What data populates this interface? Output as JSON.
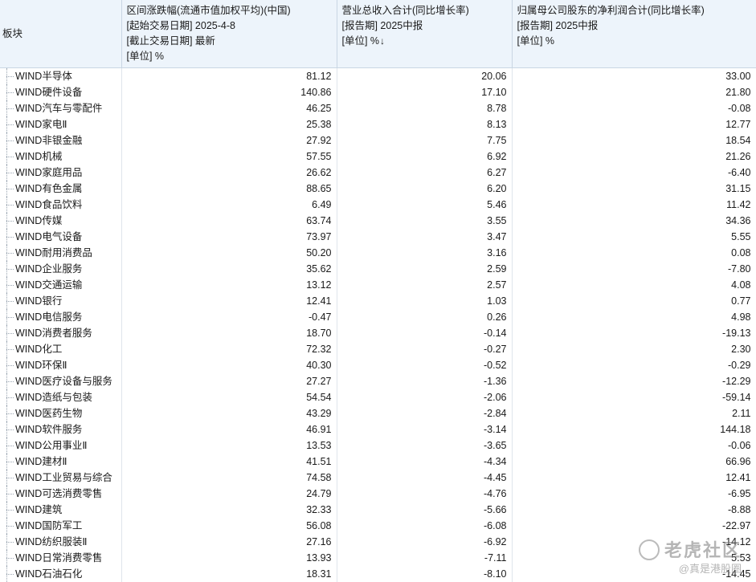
{
  "header": {
    "name_col": "板块",
    "col1": [
      "区间涨跌幅(流通市值加权平均)(中国)",
      "[起始交易日期] 2025-4-8",
      "[截止交易日期] 最新",
      "[单位] %"
    ],
    "col2": [
      "营业总收入合计(同比增长率)",
      "[报告期] 2025中报",
      "[单位] %"
    ],
    "col2_sort_icon": "↓",
    "col3": [
      "归属母公司股东的净利润合计(同比增长率)",
      "[报告期] 2025中报",
      "[单位] %"
    ]
  },
  "rows": [
    {
      "name": "WIND半导体",
      "v1": "81.12",
      "v2": "20.06",
      "v3": "33.00"
    },
    {
      "name": "WIND硬件设备",
      "v1": "140.86",
      "v2": "17.10",
      "v3": "21.80"
    },
    {
      "name": "WIND汽车与零配件",
      "v1": "46.25",
      "v2": "8.78",
      "v3": "-0.08"
    },
    {
      "name": "WIND家电Ⅱ",
      "v1": "25.38",
      "v2": "8.13",
      "v3": "12.77"
    },
    {
      "name": "WIND非银金融",
      "v1": "27.92",
      "v2": "7.75",
      "v3": "18.54"
    },
    {
      "name": "WIND机械",
      "v1": "57.55",
      "v2": "6.92",
      "v3": "21.26"
    },
    {
      "name": "WIND家庭用品",
      "v1": "26.62",
      "v2": "6.27",
      "v3": "-6.40"
    },
    {
      "name": "WIND有色金属",
      "v1": "88.65",
      "v2": "6.20",
      "v3": "31.15"
    },
    {
      "name": "WIND食品饮料",
      "v1": "6.49",
      "v2": "5.46",
      "v3": "11.42"
    },
    {
      "name": "WIND传媒",
      "v1": "63.74",
      "v2": "3.55",
      "v3": "34.36"
    },
    {
      "name": "WIND电气设备",
      "v1": "73.97",
      "v2": "3.47",
      "v3": "5.55"
    },
    {
      "name": "WIND耐用消费品",
      "v1": "50.20",
      "v2": "3.16",
      "v3": "0.08"
    },
    {
      "name": "WIND企业服务",
      "v1": "35.62",
      "v2": "2.59",
      "v3": "-7.80"
    },
    {
      "name": "WIND交通运输",
      "v1": "13.12",
      "v2": "2.57",
      "v3": "4.08"
    },
    {
      "name": "WIND银行",
      "v1": "12.41",
      "v2": "1.03",
      "v3": "0.77"
    },
    {
      "name": "WIND电信服务",
      "v1": "-0.47",
      "v2": "0.26",
      "v3": "4.98"
    },
    {
      "name": "WIND消费者服务",
      "v1": "18.70",
      "v2": "-0.14",
      "v3": "-19.13"
    },
    {
      "name": "WIND化工",
      "v1": "72.32",
      "v2": "-0.27",
      "v3": "2.30"
    },
    {
      "name": "WIND环保Ⅱ",
      "v1": "40.30",
      "v2": "-0.52",
      "v3": "-0.29"
    },
    {
      "name": "WIND医疗设备与服务",
      "v1": "27.27",
      "v2": "-1.36",
      "v3": "-12.29"
    },
    {
      "name": "WIND造纸与包装",
      "v1": "54.54",
      "v2": "-2.06",
      "v3": "-59.14"
    },
    {
      "name": "WIND医药生物",
      "v1": "43.29",
      "v2": "-2.84",
      "v3": "2.11"
    },
    {
      "name": "WIND软件服务",
      "v1": "46.91",
      "v2": "-3.14",
      "v3": "144.18"
    },
    {
      "name": "WIND公用事业Ⅱ",
      "v1": "13.53",
      "v2": "-3.65",
      "v3": "-0.06"
    },
    {
      "name": "WIND建材Ⅱ",
      "v1": "41.51",
      "v2": "-4.34",
      "v3": "66.96"
    },
    {
      "name": "WIND工业贸易与综合",
      "v1": "74.58",
      "v2": "-4.45",
      "v3": "12.41"
    },
    {
      "name": "WIND可选消费零售",
      "v1": "24.79",
      "v2": "-4.76",
      "v3": "-6.95"
    },
    {
      "name": "WIND建筑",
      "v1": "32.33",
      "v2": "-5.66",
      "v3": "-8.88"
    },
    {
      "name": "WIND国防军工",
      "v1": "56.08",
      "v2": "-6.08",
      "v3": "-22.97"
    },
    {
      "name": "WIND纺织服装Ⅱ",
      "v1": "27.16",
      "v2": "-6.92",
      "v3": "-14.12"
    },
    {
      "name": "WIND日常消费零售",
      "v1": "13.93",
      "v2": "-7.11",
      "v3": "5.53"
    },
    {
      "name": "WIND石油石化",
      "v1": "18.31",
      "v2": "-8.10",
      "v3": "-14.45"
    }
  ],
  "watermark": {
    "brand": "老虎社区",
    "handle": "@真是港股圈"
  }
}
